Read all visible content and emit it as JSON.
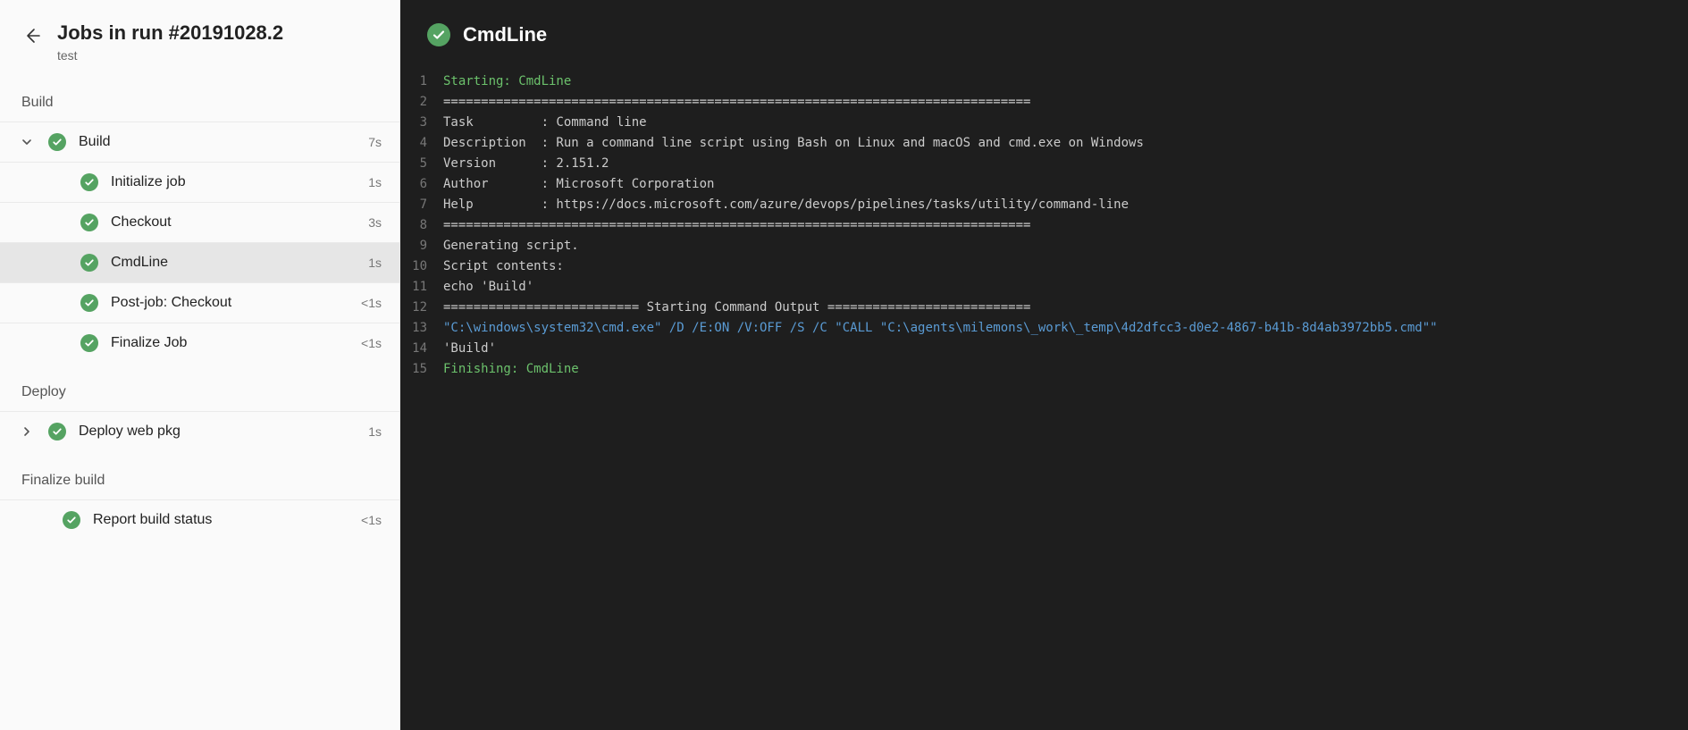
{
  "header": {
    "title": "Jobs in run #20191028.2",
    "subtitle": "test"
  },
  "sections": [
    {
      "label": "Build",
      "jobs": [
        {
          "name": "Build",
          "time": "7s",
          "expanded": true,
          "status": "success",
          "steps": [
            {
              "name": "Initialize job",
              "time": "1s",
              "status": "success"
            },
            {
              "name": "Checkout",
              "time": "3s",
              "status": "success"
            },
            {
              "name": "CmdLine",
              "time": "1s",
              "status": "success",
              "selected": true
            },
            {
              "name": "Post-job: Checkout",
              "time": "<1s",
              "status": "success"
            },
            {
              "name": "Finalize Job",
              "time": "<1s",
              "status": "success"
            }
          ]
        }
      ]
    },
    {
      "label": "Deploy",
      "jobs": [
        {
          "name": "Deploy web pkg",
          "time": "1s",
          "expanded": false,
          "status": "success",
          "steps": []
        }
      ]
    },
    {
      "label": "Finalize build",
      "jobs": [
        {
          "name": "Report build status",
          "time": "<1s",
          "expanded": null,
          "status": "success",
          "steps": []
        }
      ]
    }
  ],
  "task": {
    "title": "CmdLine",
    "status": "success",
    "log": [
      {
        "n": 1,
        "text": "Starting: CmdLine",
        "cls": "green"
      },
      {
        "n": 2,
        "text": "=============================================================================="
      },
      {
        "n": 3,
        "text": "Task         : Command line"
      },
      {
        "n": 4,
        "text": "Description  : Run a command line script using Bash on Linux and macOS and cmd.exe on Windows"
      },
      {
        "n": 5,
        "text": "Version      : 2.151.2"
      },
      {
        "n": 6,
        "text": "Author       : Microsoft Corporation"
      },
      {
        "n": 7,
        "text": "Help         : https://docs.microsoft.com/azure/devops/pipelines/tasks/utility/command-line"
      },
      {
        "n": 8,
        "text": "=============================================================================="
      },
      {
        "n": 9,
        "text": "Generating script."
      },
      {
        "n": 10,
        "text": "Script contents:"
      },
      {
        "n": 11,
        "text": "echo 'Build'"
      },
      {
        "n": 12,
        "text": "========================== Starting Command Output ==========================="
      },
      {
        "n": 13,
        "text": "\"C:\\windows\\system32\\cmd.exe\" /D /E:ON /V:OFF /S /C \"CALL \"C:\\agents\\milemons\\_work\\_temp\\4d2dfcc3-d0e2-4867-b41b-8d4ab3972bb5.cmd\"\"",
        "cls": "blue"
      },
      {
        "n": 14,
        "text": "'Build'"
      },
      {
        "n": 15,
        "text": "Finishing: CmdLine",
        "cls": "green"
      }
    ]
  }
}
